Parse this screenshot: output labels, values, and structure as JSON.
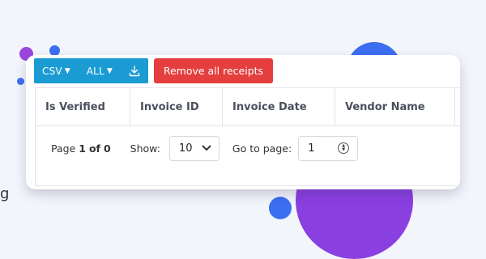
{
  "toolbar": {
    "format": {
      "label": "CSV",
      "icon": "chevron-down-icon"
    },
    "scope": {
      "label": "ALL",
      "icon": "chevron-down-icon"
    },
    "download_icon": "download-icon",
    "remove_label": "Remove all receipts"
  },
  "table": {
    "columns": [
      "Is Verified",
      "Invoice ID",
      "Invoice Date",
      "Vendor Name"
    ]
  },
  "pagination": {
    "page_label": "Page",
    "page_current": "1",
    "page_of": "of",
    "page_total": "0",
    "show_label": "Show:",
    "page_size": "10",
    "goto_label": "Go to page:",
    "goto_value": "1"
  },
  "edge_text": "g",
  "colors": {
    "primary_button": "#1b9bd3",
    "danger_button": "#e53e3e",
    "decor_purple": "#8a3fe0",
    "decor_blue": "#3b6ff0"
  }
}
